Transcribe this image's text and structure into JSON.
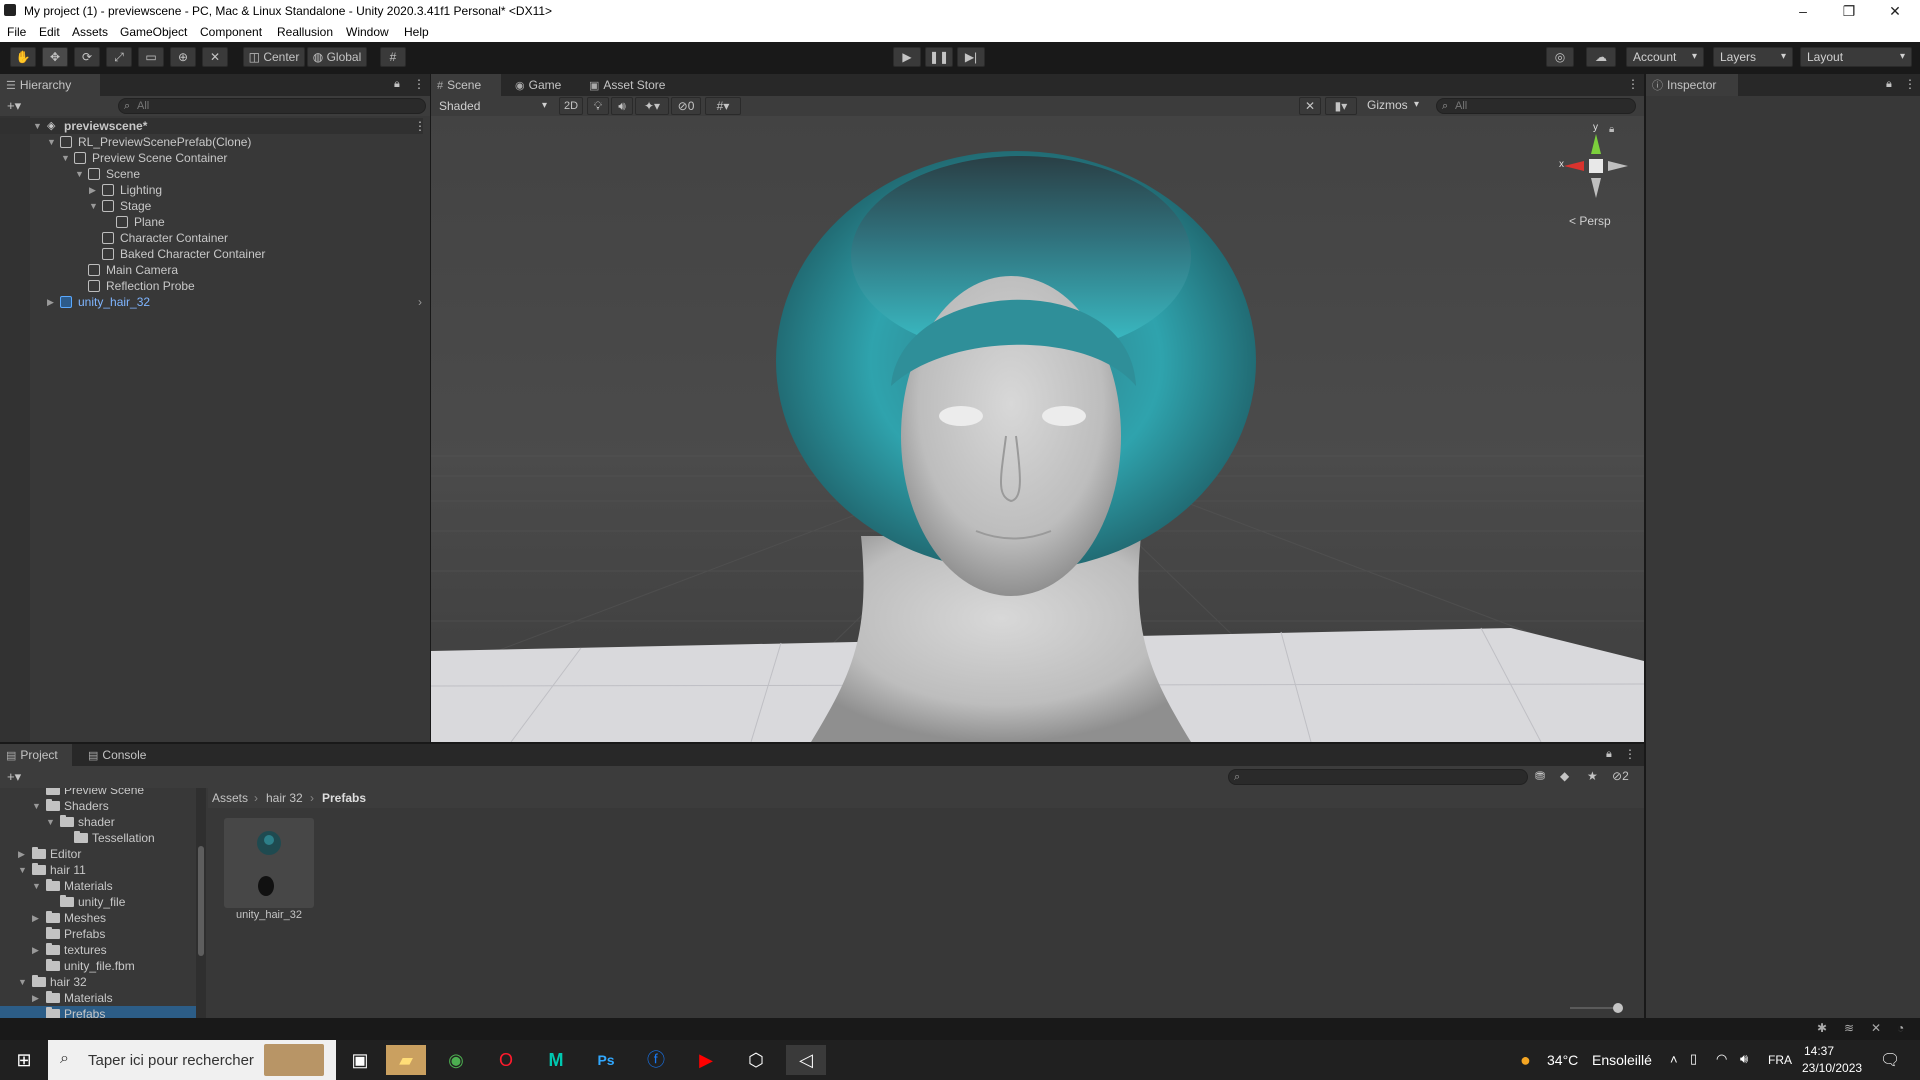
{
  "window": {
    "title": "My project (1) - previewscene - PC, Mac & Linux Standalone - Unity 2020.3.41f1 Personal* <DX11>",
    "minimize": "–",
    "restore": "❐",
    "close": "✕"
  },
  "menu": [
    "File",
    "Edit",
    "Assets",
    "GameObject",
    "Component",
    "Reallusion",
    "Window",
    "Help"
  ],
  "toolbar": {
    "pivot": "Center",
    "space": "Global",
    "account": "Account",
    "layers": "Layers",
    "layout": "Layout"
  },
  "hierarchy": {
    "tab": "Hierarchy",
    "search_placeholder": "All",
    "add": "+▾",
    "items": [
      {
        "label": "previewscene*",
        "depth": 0
      },
      {
        "label": "RL_PreviewScenePrefab(Clone)",
        "depth": 1
      },
      {
        "label": "Preview Scene Container",
        "depth": 2
      },
      {
        "label": "Scene",
        "depth": 3
      },
      {
        "label": "Lighting",
        "depth": 4
      },
      {
        "label": "Stage",
        "depth": 4
      },
      {
        "label": "Plane",
        "depth": 5
      },
      {
        "label": "Character Container",
        "depth": 4
      },
      {
        "label": "Baked Character Container",
        "depth": 4
      },
      {
        "label": "Main Camera",
        "depth": 3
      },
      {
        "label": "Reflection Probe",
        "depth": 3
      },
      {
        "label": "unity_hair_32",
        "depth": 1
      }
    ]
  },
  "scene": {
    "tabs": [
      "Scene",
      "Game",
      "Asset Store"
    ],
    "shading": "Shaded",
    "mode2d": "2D",
    "hidden_count": "0",
    "gizmos": "Gizmos",
    "search_placeholder": "All",
    "persp": "< Persp",
    "gizmo_x": "x",
    "gizmo_y": "y"
  },
  "inspector": {
    "tab": "Inspector"
  },
  "project": {
    "tabs": [
      "Project",
      "Console"
    ],
    "add": "+▾",
    "hidden_count": "2",
    "breadcrumb": [
      "Assets",
      "hair 32",
      "Prefabs"
    ],
    "tree": [
      {
        "label": "Preview Scene",
        "depth": 2
      },
      {
        "label": "Shaders",
        "depth": 2
      },
      {
        "label": "shader",
        "depth": 3
      },
      {
        "label": "Tessellation",
        "depth": 4
      },
      {
        "label": "Editor",
        "depth": 1
      },
      {
        "label": "hair 11",
        "depth": 1
      },
      {
        "label": "Materials",
        "depth": 2
      },
      {
        "label": "unity_file",
        "depth": 3
      },
      {
        "label": "Meshes",
        "depth": 2
      },
      {
        "label": "Prefabs",
        "depth": 2
      },
      {
        "label": "textures",
        "depth": 2
      },
      {
        "label": "unity_file.fbm",
        "depth": 2
      },
      {
        "label": "hair 32",
        "depth": 1
      },
      {
        "label": "Materials",
        "depth": 2
      },
      {
        "label": "Prefabs",
        "depth": 2
      }
    ],
    "asset": {
      "label": "unity_hair_32"
    }
  },
  "taskbar": {
    "search_placeholder": "Taper ici pour rechercher",
    "weather_temp": "34°C",
    "weather_desc": "Ensoleillé",
    "lang": "FRA",
    "time": "14:37",
    "date": "23/10/2023"
  }
}
